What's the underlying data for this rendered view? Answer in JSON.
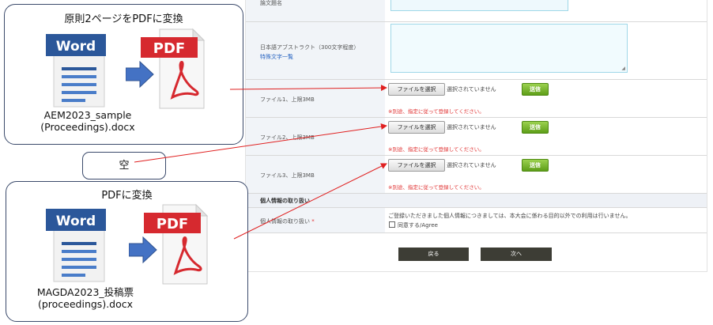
{
  "form": {
    "title_label": "論文題名",
    "abstract_label": "日本語アブストラクト（300文字程度）",
    "special_chars_link": "特殊文字一覧",
    "files": [
      {
        "label": "ファイル1、上限3MB",
        "choose_label": "ファイルを選択",
        "status": "選択されていません",
        "send_label": "送信",
        "note": "※別途、指定に従って登録してください。"
      },
      {
        "label": "ファイル2、上限3MB",
        "choose_label": "ファイルを選択",
        "status": "選択されていません",
        "send_label": "送信",
        "note": "※別途、指定に従って登録してください。"
      },
      {
        "label": "ファイル3、上限3MB",
        "choose_label": "ファイルを選択",
        "status": "選択されていません",
        "send_label": "送信",
        "note": "※別途、指定に従って登録してください。"
      }
    ],
    "privacy_section": "個人情報の取り扱い",
    "privacy_label": "個人情報の取り扱い",
    "required_mark": "*",
    "privacy_text": "ご登録いただきました個人情報につきましては、本大会に係わる目的以外での利用は行いません。",
    "agree_label": "同意する/Agree",
    "back_label": "戻る",
    "next_label": "次へ"
  },
  "annotations": {
    "box1_title": "原則2ページをPDFに変換",
    "box1_filename_line1": "AEM2023_sample",
    "box1_filename_line2": "(Proceedings).docx",
    "empty_label": "空",
    "box2_title": "PDFに変換",
    "box2_filename_line1": "MAGDA2023_投稿票",
    "box2_filename_line2": "(proceedings).docx",
    "word_text": "Word",
    "pdf_text": "PDF"
  },
  "colors": {
    "annotation_arrow": "#e02020",
    "word_blue": "#2b579a",
    "pdf_red": "#d6292f",
    "send_green": "#6aab22"
  }
}
